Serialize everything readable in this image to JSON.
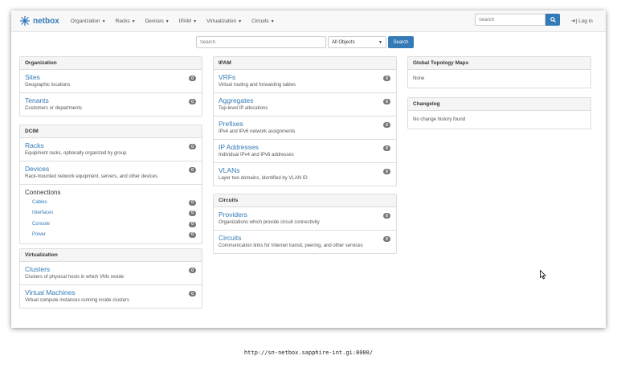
{
  "brand": {
    "name": "netbox"
  },
  "nav": {
    "items": [
      {
        "label": "Organization"
      },
      {
        "label": "Racks"
      },
      {
        "label": "Devices"
      },
      {
        "label": "IPAM"
      },
      {
        "label": "Virtualization"
      },
      {
        "label": "Circuits"
      }
    ],
    "search_placeholder": "Search",
    "login_label": "Log in"
  },
  "search": {
    "placeholder": "Search",
    "select_value": "All Objects",
    "button_label": "Search"
  },
  "panels": {
    "organization": {
      "title": "Organization",
      "items": [
        {
          "label": "Sites",
          "desc": "Geographic locations",
          "count": "0"
        },
        {
          "label": "Tenants",
          "desc": "Customers or departments",
          "count": "0"
        }
      ]
    },
    "dcim": {
      "title": "DCIM",
      "items": [
        {
          "label": "Racks",
          "desc": "Equipment racks, optionally organized by group",
          "count": "0"
        },
        {
          "label": "Devices",
          "desc": "Rack-mounted network equipment, servers, and other devices",
          "count": "0"
        }
      ],
      "connections": {
        "title": "Connections",
        "items": [
          {
            "label": "Cables",
            "count": "0"
          },
          {
            "label": "Interfaces",
            "count": "0"
          },
          {
            "label": "Console",
            "count": "0"
          },
          {
            "label": "Power",
            "count": "0"
          }
        ]
      }
    },
    "virtualization": {
      "title": "Virtualization",
      "items": [
        {
          "label": "Clusters",
          "desc": "Clusters of physical hosts in which VMs reside",
          "count": "0"
        },
        {
          "label": "Virtual Machines",
          "desc": "Virtual compute instances running inside clusters",
          "count": "0"
        }
      ]
    },
    "ipam": {
      "title": "IPAM",
      "items": [
        {
          "label": "VRFs",
          "desc": "Virtual routing and forwarding tables",
          "count": "0"
        },
        {
          "label": "Aggregates",
          "desc": "Top-level IP allocations",
          "count": "0"
        },
        {
          "label": "Prefixes",
          "desc": "IPv4 and IPv6 network assignments",
          "count": "0"
        },
        {
          "label": "IP Addresses",
          "desc": "Individual IPv4 and IPv6 addresses",
          "count": "0"
        },
        {
          "label": "VLANs",
          "desc": "Layer two domains, identified by VLAN ID",
          "count": "0"
        }
      ]
    },
    "circuits": {
      "title": "Circuits",
      "items": [
        {
          "label": "Providers",
          "desc": "Organizations which provide circuit connectivity",
          "count": "0"
        },
        {
          "label": "Circuits",
          "desc": "Communication links for Internet transit, peering, and other services",
          "count": "0"
        }
      ]
    },
    "topology": {
      "title": "Global Topology Maps",
      "text": "None"
    },
    "changelog": {
      "title": "Changelog",
      "text": "No change history found"
    }
  },
  "footer": {
    "url": "http://sn-netbox.sapphire-int.gi:8000/"
  },
  "colors": {
    "accent": "#337ab7",
    "badge": "#777777"
  }
}
